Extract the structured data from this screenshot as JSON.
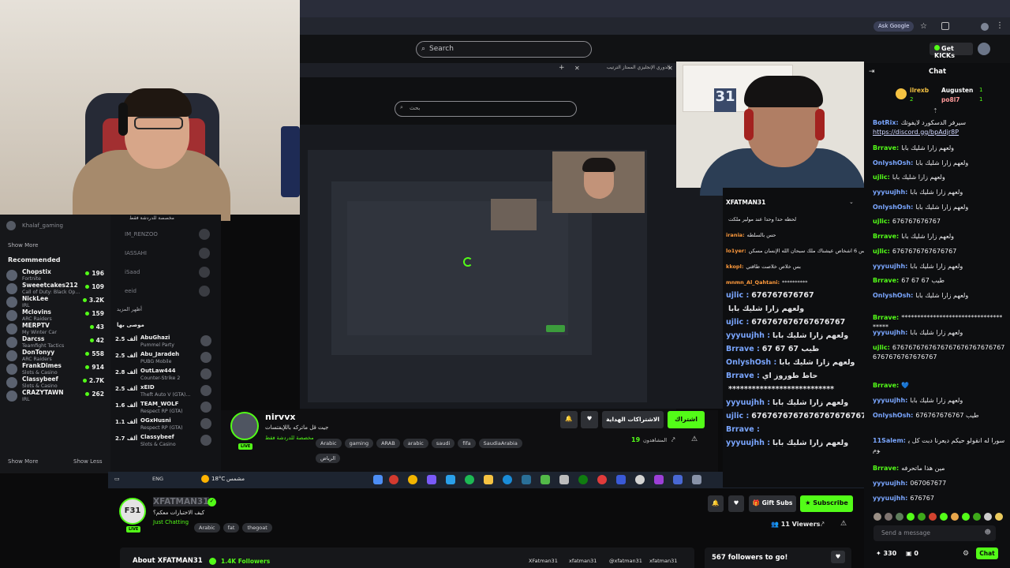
{
  "browser": {
    "search_placeholder": "Search",
    "ask_google": "Ask Google",
    "get_kicks": "Get KICKs"
  },
  "nested": {
    "tab_title": "الدوري الإنجليزي الممتاز الترتيب",
    "search_placeholder": "بحث"
  },
  "sidebar": {
    "top_item": "Khalaf_gaming",
    "show_more": "Show More",
    "recommended": "Recommended",
    "items": [
      {
        "name": "Chopstix",
        "game": "Fortnite",
        "viewers": "196"
      },
      {
        "name": "Sweeetcakes212",
        "game": "Call of Duty: Black Op...",
        "viewers": "109"
      },
      {
        "name": "NickLee",
        "game": "IRL",
        "viewers": "3.2K"
      },
      {
        "name": "Mclovins",
        "game": "ARC Raiders",
        "viewers": "159"
      },
      {
        "name": "MERPTV",
        "game": "My Winter Car",
        "viewers": "43"
      },
      {
        "name": "Darcss",
        "game": "Teamfight Tactics",
        "viewers": "42"
      },
      {
        "name": "DonTonyy",
        "game": "ARC Raiders",
        "viewers": "558"
      },
      {
        "name": "FrankDimes",
        "game": "Slots & Casino",
        "viewers": "914"
      },
      {
        "name": "Classybeef",
        "game": "Slots & Casino",
        "viewers": "2.7K"
      },
      {
        "name": "CRAZYTAWN",
        "game": "IRL",
        "viewers": "262"
      }
    ],
    "show_more_bottom": "Show More",
    "show_less": "Show Less"
  },
  "sidebar2": {
    "header_ar": "مخصصة للدردشة فقط",
    "ghosts": [
      "IM_RENZOO",
      "IASSAHI",
      "iSaad",
      "eeid"
    ],
    "more_ar": "أظهر المزيد",
    "recommended_ar": "موصى بها",
    "items": [
      {
        "count": "2.5 ألف",
        "name": "AbuGhazi",
        "game": "Pummel Party"
      },
      {
        "count": "2.5 ألف",
        "name": "Abu_Jaradeh",
        "game": "PUBG Mobile"
      },
      {
        "count": "2.8 ألف",
        "name": "OutLaw444",
        "game": "Counter-Strike 2"
      },
      {
        "count": "2.5 ألف",
        "name": "xEID",
        "game": "Theft Auto V (GTA)..."
      },
      {
        "count": "1.6 ألف",
        "name": "TEAM_WOLF",
        "game": "Respect RP (GTA)"
      },
      {
        "count": "1.1 ألف",
        "name": "OGxHusni",
        "game": "Respect RP (GTA)"
      },
      {
        "count": "2.7 ألف",
        "name": "Classybeef",
        "game": "Slots & Casino"
      }
    ]
  },
  "channel1": {
    "name": "nirvvx",
    "title": "جيت قل ماتركه باللإيفتسات",
    "category": "مخصصة للدردشة فقط",
    "tags": [
      "Arabic",
      "gaming",
      "ARAB",
      "arabic",
      "saudi",
      "fifa",
      "SaudiaArabia",
      "الرياض"
    ],
    "subscribe": "اشتراك",
    "gift": "الاشتراكات الهداية",
    "viewers": "19",
    "viewers_label": "المشاهدون"
  },
  "taskbar": {
    "weather": "18°C",
    "weather_ar": "مشمس",
    "lang": "ENG"
  },
  "midchat": {
    "channel": "XFATMAN31",
    "lines": [
      {
        "user": "",
        "text": "لحظه حدا وحدا عند مولير ملكت"
      },
      {
        "user": "irania:",
        "text": "حس بالسلطه"
      },
      {
        "user": "lo1yer:",
        "text": "ارفنا بس 6 اشخاص عيشناك ملك سبحان الله الإنسان مسكن"
      },
      {
        "user": "kkopl:",
        "text": "بس خلاص خلاصت طاقتي"
      },
      {
        "user": "mnmn_Al_Qahtani:",
        "text": "**********"
      }
    ],
    "big_lines": [
      {
        "user": "ujlic :",
        "text": "676767676767"
      },
      {
        "user": "",
        "text": "ولعهم زارا شليك بابا"
      },
      {
        "user": "ujlic :",
        "text": "676767676767676767"
      },
      {
        "user": "yyyuujhh :",
        "text": "ولعهم زارا شليك بابا"
      },
      {
        "user": "Brrave :",
        "text": "67 67 67 طيب"
      },
      {
        "user": "OnlyshOsh :",
        "text": "ولعهم زارا شليك بابا"
      },
      {
        "user": "Brrave :",
        "text": "حاط طوروز اي"
      },
      {
        "user": "",
        "text": "***************************"
      },
      {
        "user": "yyyuujhh :",
        "text": "ولعهم زارا شليك بابا"
      },
      {
        "user": "ujlic :",
        "text": "67676767676767676767676767676767676767676767"
      },
      {
        "user": "Brrave :",
        "text": ""
      },
      {
        "user": "yyyuujhh :",
        "text": "ولعهم زارا شليك بابا"
      }
    ]
  },
  "channel2": {
    "name": "XFATMAN31",
    "avatar_text": "F31",
    "title": "كيف الاختبارات معكم؟",
    "category": "Just Chatting",
    "tags": [
      "Arabic",
      "fat",
      "thegoat"
    ],
    "gift": "Gift Subs",
    "subscribe": "Subscribe",
    "viewers": "11 Viewers",
    "about": "About XFATMAN31",
    "followers": "1.4K Followers",
    "socials": [
      "XFatman31",
      "xfatman31",
      "@xfatman31",
      "xfatman31"
    ],
    "goal": "567 followers to go!"
  },
  "chat": {
    "title": "Chat",
    "top": [
      {
        "name": "ilrexb",
        "badge": "2"
      },
      {
        "name": "Augusten",
        "badge": "1"
      },
      {
        "name": "po8l7",
        "badge": "1"
      }
    ],
    "messages": [
      {
        "user": "BotRix:",
        "text": "سيرفر الدسكورد لايفوتك",
        "link": "https://discord.gg/bpAdjr8P",
        "color": "#7aa6ff"
      },
      {
        "user": "Brrave:",
        "text": "ولعهم زارا شليك بابا",
        "color": "#53fc18"
      },
      {
        "user": "OnlyshOsh:",
        "text": "ولعهم زارا شليك بابا",
        "color": "#7aa6ff"
      },
      {
        "user": "ujlic:",
        "text": "ولعهم زارا شليك بابا",
        "color": "#53fc18"
      },
      {
        "user": "yyyuujhh:",
        "text": "ولعهم زارا شليك بابا",
        "color": "#7aa6ff"
      },
      {
        "user": "OnlyshOsh:",
        "text": "ولعهم زارا شليك بابا",
        "color": "#7aa6ff"
      },
      {
        "user": "ujlic:",
        "text": "676767676767",
        "color": "#53fc18"
      },
      {
        "user": "Brrave:",
        "text": "ولعهم زارا شليك بابا",
        "color": "#53fc18"
      },
      {
        "user": "ujlic:",
        "text": "6767676767676767",
        "color": "#53fc18"
      },
      {
        "user": "yyyuujhh:",
        "text": "ولعهم زارا شليك بابا",
        "color": "#7aa6ff"
      },
      {
        "user": "Brrave:",
        "text": "67 67 67 طيب",
        "color": "#53fc18"
      },
      {
        "user": "OnlyshOsh:",
        "text": "ولعهم زارا شليك بابا",
        "color": "#7aa6ff"
      },
      {
        "user": "Brrave:",
        "text": "*************************************",
        "color": "#53fc18"
      },
      {
        "user": "yyyuujhh:",
        "text": "ولعهم زارا شليك بابا",
        "color": "#7aa6ff"
      },
      {
        "user": "ujlic:",
        "text": "67676767676767676767676767676767676767676767",
        "color": "#53fc18"
      },
      {
        "user": "Brrave:",
        "text": "💙",
        "color": "#53fc18"
      },
      {
        "user": "yyyuujhh:",
        "text": "ولعهم زارا شليك بابا",
        "color": "#7aa6ff"
      },
      {
        "user": "OnlyshOsh:",
        "text": "676767676767 طيب",
        "color": "#7aa6ff"
      },
      {
        "user": "11Salem:",
        "text": "سورا له انقولو حيكم ديعرنا دبت كل يوم",
        "color": "#7aa6ff"
      },
      {
        "user": "Brrave:",
        "text": "مين هذا ماتحرفه",
        "color": "#53fc18"
      },
      {
        "user": "yyyuujhh:",
        "text": "067067677",
        "color": "#7aa6ff"
      },
      {
        "user": "yyyuujhh:",
        "text": "676767",
        "color": "#7aa6ff"
      }
    ],
    "send_placeholder": "Send a message",
    "points": "330",
    "zero": "0",
    "chat_button": "Chat"
  }
}
